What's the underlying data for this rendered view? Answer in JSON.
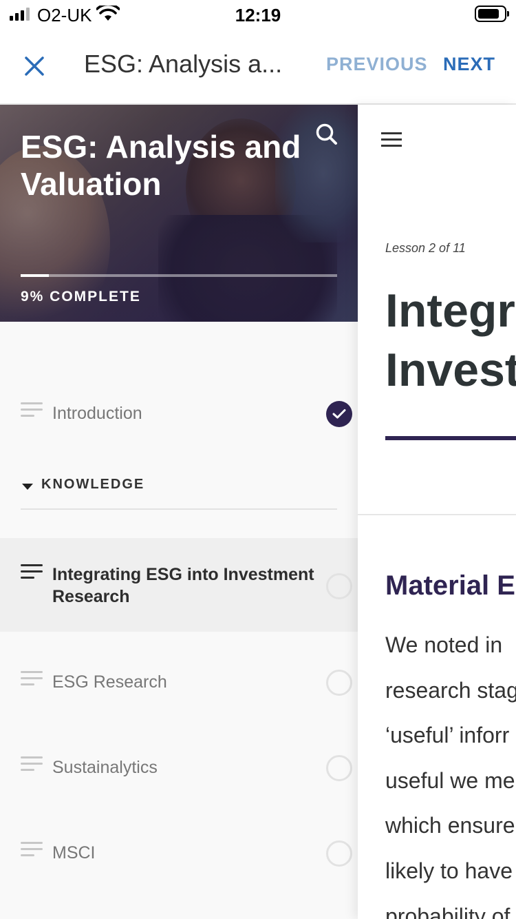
{
  "status_bar": {
    "carrier": "O2-UK",
    "time": "12:19",
    "icons": [
      "signal-icon",
      "wifi-icon",
      "battery-icon"
    ]
  },
  "nav": {
    "title": "ESG: Analysis a...",
    "previous_label": "PREVIOUS",
    "next_label": "NEXT",
    "close_icon": "close-icon",
    "colors": {
      "accent": "#2b6cb8",
      "disabled": "#8fb0d3"
    }
  },
  "sidebar": {
    "course_title": "ESG: Analysis and Valuation",
    "progress_percent": 9,
    "progress_label": "9% COMPLETE",
    "search_icon": "search-icon",
    "intro_item": {
      "label": "Introduction",
      "status": "complete"
    },
    "section": {
      "label": "KNOWLEDGE",
      "expanded": true
    },
    "items": [
      {
        "label": "Integrating ESG into Investment Research",
        "status": "incomplete",
        "active": true
      },
      {
        "label": "ESG Research",
        "status": "incomplete",
        "active": false
      },
      {
        "label": "Sustainalytics",
        "status": "incomplete",
        "active": false
      },
      {
        "label": "MSCI",
        "status": "incomplete",
        "active": false
      }
    ]
  },
  "main": {
    "menu_icon": "menu-icon",
    "lesson_counter": "Lesson 2 of 11",
    "lesson_title_lines": [
      "Integra",
      "Invest"
    ],
    "section_heading": "Material E",
    "body_lines": [
      "We noted in",
      "research stag",
      "‘useful’ inforr",
      "useful we me",
      "which ensure",
      "likely to have",
      "probability of"
    ],
    "colors": {
      "brand": "#2f2452"
    }
  }
}
